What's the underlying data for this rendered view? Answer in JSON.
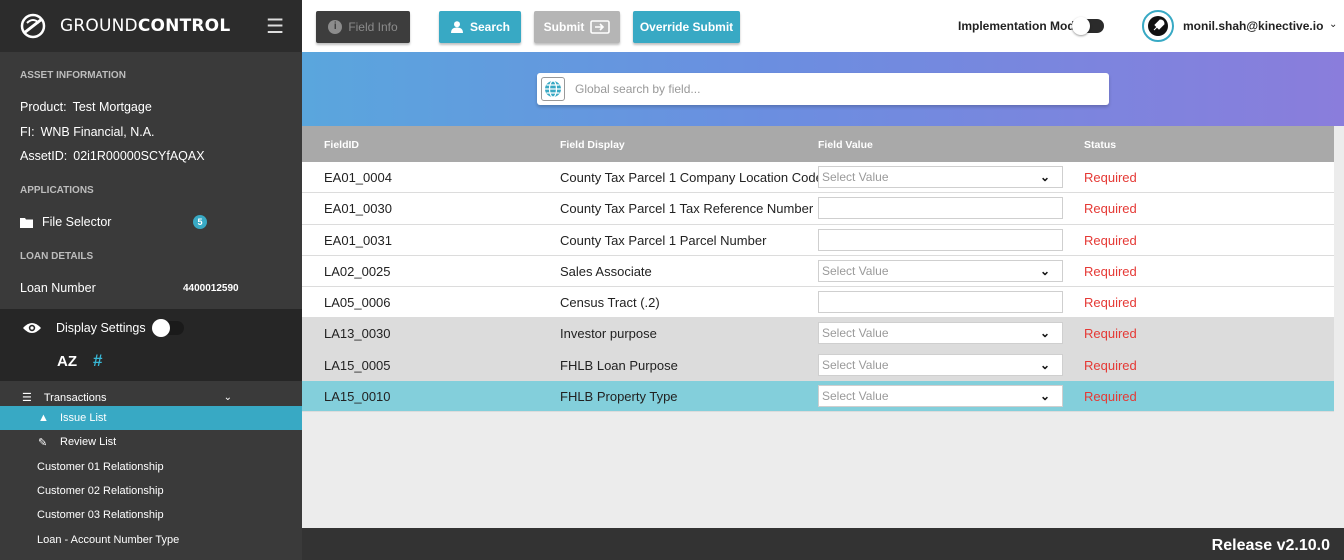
{
  "brand": {
    "name_light": "GROUND",
    "name_bold": "CONTROL"
  },
  "sidebar": {
    "asset_section": "ASSET INFORMATION",
    "product_key": "Product:",
    "product_val": "Test Mortgage",
    "fi_key": "FI:",
    "fi_val": "WNB Financial, N.A.",
    "assetid_key": "AssetID:",
    "assetid_val": "02i1R00000SCYfAQAX",
    "applications_section": "APPLICATIONS",
    "file_selector_label": "File Selector",
    "file_selector_badge": "5",
    "loan_section": "LOAN DETAILS",
    "loan_number_label": "Loan Number",
    "loan_number_val": "4400012590",
    "display_settings_label": "Display Settings",
    "az_label": "AZ",
    "hash_label": "#",
    "transactions_label": "Transactions",
    "items": [
      {
        "label": "Issue List",
        "icon": "warning-icon"
      },
      {
        "label": "Review List",
        "icon": "review-icon"
      },
      {
        "label": "Customer 01 Relationship"
      },
      {
        "label": "Customer 02 Relationship"
      },
      {
        "label": "Customer 03 Relationship"
      },
      {
        "label": "Loan - Account Number Type"
      }
    ]
  },
  "toolbar": {
    "field_info": "Field Info",
    "search": "Search",
    "submit": "Submit",
    "override_submit": "Override Submit",
    "implementation_mode": "Implementation Mode",
    "user": "monil.shah@kinective.io"
  },
  "search": {
    "placeholder": "Global search by field..."
  },
  "table": {
    "headers": [
      "FieldID",
      "Field Display",
      "Field Value",
      "Status"
    ],
    "rows": [
      {
        "id": "EA01_0004",
        "display": "County Tax Parcel 1 Company Location Code",
        "value": "Select Value",
        "status": "Required"
      },
      {
        "id": "EA01_0030",
        "display": "County Tax Parcel 1 Tax Reference Number",
        "value": "",
        "status": "Required"
      },
      {
        "id": "EA01_0031",
        "display": "County Tax Parcel 1 Parcel Number",
        "value": "",
        "status": "Required"
      },
      {
        "id": "LA02_0025",
        "display": "Sales Associate",
        "value": "Select Value",
        "status": "Required"
      },
      {
        "id": "LA05_0006",
        "display": "Census Tract (.2)",
        "value": "",
        "status": "Required"
      },
      {
        "id": "LA13_0030",
        "display": "Investor purpose",
        "value": "Select Value",
        "status": "Required"
      },
      {
        "id": "LA15_0005",
        "display": "FHLB Loan Purpose",
        "value": "Select Value",
        "status": "Required"
      },
      {
        "id": "LA15_0010",
        "display": "FHLB Property Type",
        "value": "Select Value",
        "status": "Required"
      }
    ]
  },
  "footer": {
    "release": "Release v2.10.0"
  },
  "colors": {
    "accent": "#38a9c4",
    "required": "#e53935",
    "sidebar": "#3a3a3a"
  }
}
